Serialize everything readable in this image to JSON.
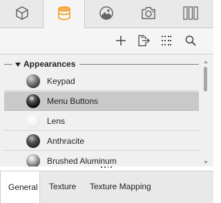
{
  "top_tabs": [
    {
      "icon": "cube-icon",
      "active": false
    },
    {
      "icon": "cylinder-material-icon",
      "active": true
    },
    {
      "icon": "image-icon",
      "active": false
    },
    {
      "icon": "camera-icon",
      "active": false
    },
    {
      "icon": "columns-icon",
      "active": false
    }
  ],
  "toolbar": {
    "buttons": [
      "add-icon",
      "export-icon",
      "grid-view-icon",
      "search-icon"
    ]
  },
  "group": {
    "title": "Appearances",
    "expanded": true
  },
  "items": [
    {
      "label": "Keypad",
      "swatch": "keypad",
      "selected": false
    },
    {
      "label": "Menu Buttons",
      "swatch": "menu",
      "selected": true
    },
    {
      "label": "Lens",
      "swatch": "lens",
      "selected": false
    },
    {
      "label": "Anthracite",
      "swatch": "anthracite",
      "selected": false
    },
    {
      "label": "Brushed Aluminum",
      "swatch": "brushed",
      "selected": false
    }
  ],
  "bottom_tabs": [
    {
      "label": "General",
      "active": true
    },
    {
      "label": "Texture",
      "active": false
    },
    {
      "label": "Texture Mapping",
      "active": false
    }
  ],
  "colors": {
    "accent_orange": "#f39a1e",
    "selection": "#c9c9c9",
    "icon_gray": "#666666"
  }
}
